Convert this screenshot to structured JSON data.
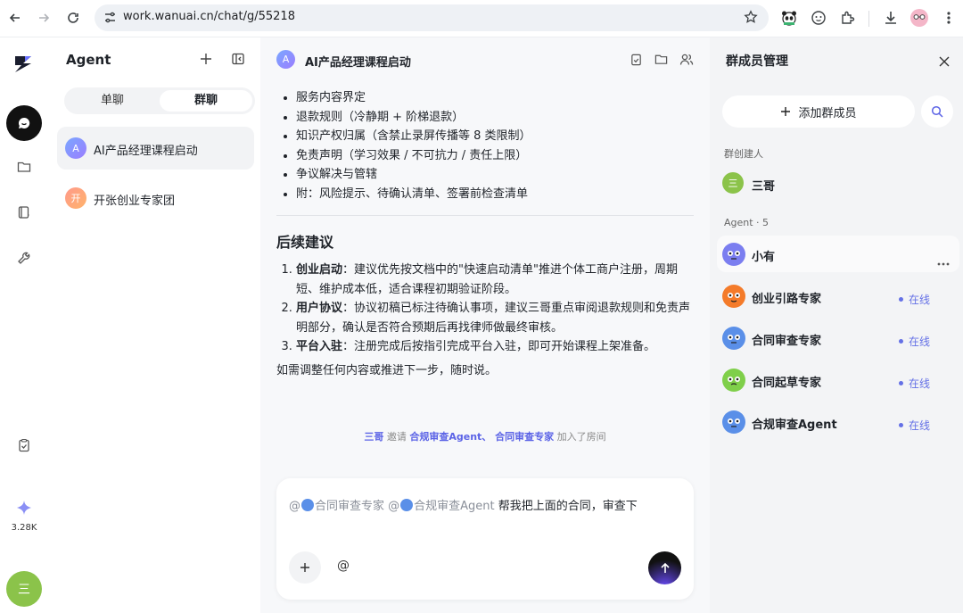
{
  "browser": {
    "url": "work.wanuai.cn/chat/g/55218"
  },
  "rail": {
    "credits": "3.28K",
    "user_initial": "三"
  },
  "list_panel": {
    "title": "Agent",
    "tabs": [
      "单聊",
      "群聊"
    ],
    "active_tab": "群聊",
    "items": [
      {
        "initial": "A",
        "name": "AI产品经理课程启动"
      },
      {
        "initial": "开",
        "name": "开张创业专家团"
      }
    ]
  },
  "chat": {
    "header": {
      "initial": "A",
      "title": "AI产品经理课程启动"
    },
    "bullets": [
      "服务内容界定",
      "退款规则（冷静期 + 阶梯退款）",
      "知识产权归属（含禁止录屏传播等 8 类限制）",
      "免责声明（学习效果 / 不可抗力 / 责任上限）",
      "争议解决与管辖",
      "附：风险提示、待确认清单、签署前检查清单"
    ],
    "section_title": "后续建议",
    "numbered": [
      {
        "label": "创业启动",
        "text": "：建议优先按文档中的\"快速启动清单\"推进个体工商户注册，周期短、维护成本低，适合课程初期验证阶段。"
      },
      {
        "label": "用户协议",
        "text": "：协议初稿已标注待确认事项，建议三哥重点审阅退款规则和免责声明部分，确认是否符合预期后再找律师做最终审核。"
      },
      {
        "label": "平台入驻",
        "text": "：注册完成后按指引完成平台入驻，即可开始课程上架准备。"
      }
    ],
    "closing": "如需调整任何内容或推进下一步，随时说。",
    "system": {
      "inviter": "三哥",
      "verb": "邀请",
      "invitees": "合规审查Agent、 合同审查专家",
      "suffix": "加入了房间"
    },
    "composer": {
      "mention1": "@",
      "mention1_name": "合同审查专家",
      "mention2": "@",
      "mention2_name": "合规审查Agent",
      "text": "帮我把上面的合同，审查下",
      "at_button": "@"
    }
  },
  "members": {
    "title": "群成员管理",
    "add_button": "添加群成员",
    "creator_label": "群创建人",
    "creator": {
      "initial": "三",
      "name": "三哥"
    },
    "agent_label": "Agent · 5",
    "agents": [
      {
        "name": "小有",
        "status": "",
        "color": "#7b7ef0"
      },
      {
        "name": "创业引路专家",
        "status": "在线",
        "color": "#f47b2a"
      },
      {
        "name": "合同审查专家",
        "status": "在线",
        "color": "#5a8fe8"
      },
      {
        "name": "合同起草专家",
        "status": "在线",
        "color": "#7fcf4a"
      },
      {
        "name": "合规审查Agent",
        "status": "在线",
        "color": "#5a8fe8"
      }
    ]
  }
}
